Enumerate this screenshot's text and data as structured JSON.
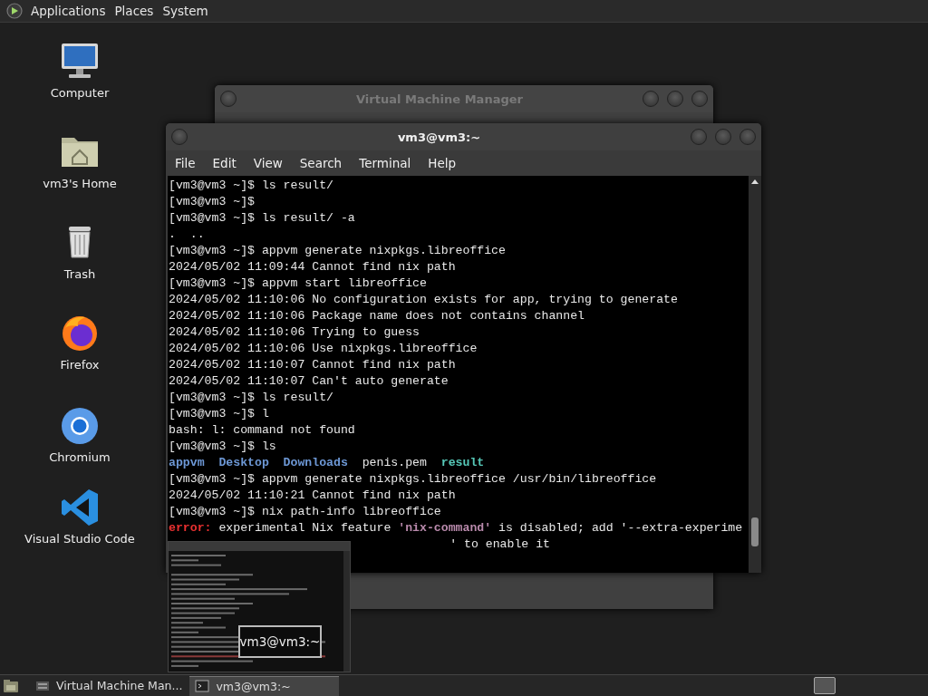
{
  "top_panel": {
    "menus": [
      {
        "label": "Applications"
      },
      {
        "label": "Places"
      },
      {
        "label": "System"
      }
    ]
  },
  "desktop_icons": [
    {
      "label": "Computer",
      "kind": "computer"
    },
    {
      "label": "vm3's Home",
      "kind": "home"
    },
    {
      "label": "Trash",
      "kind": "trash"
    },
    {
      "label": "Firefox",
      "kind": "firefox"
    },
    {
      "label": "Chromium",
      "kind": "chromium"
    },
    {
      "label": "Visual Studio Code",
      "kind": "code"
    }
  ],
  "background_window": {
    "title": "Virtual Machine Manager"
  },
  "terminal_window": {
    "title": "vm3@vm3:~",
    "menu": [
      {
        "label": "File"
      },
      {
        "label": "Edit"
      },
      {
        "label": "View"
      },
      {
        "label": "Search"
      },
      {
        "label": "Terminal"
      },
      {
        "label": "Help"
      }
    ],
    "lines": [
      {
        "segments": [
          {
            "text": "[vm3@vm3 ~]$ ls result/",
            "kind": "plain"
          }
        ]
      },
      {
        "segments": [
          {
            "text": "[vm3@vm3 ~]$",
            "kind": "plain"
          }
        ]
      },
      {
        "segments": [
          {
            "text": "[vm3@vm3 ~]$ ls result/ -a",
            "kind": "plain"
          }
        ]
      },
      {
        "segments": [
          {
            "text": ".  ..",
            "kind": "plain"
          }
        ]
      },
      {
        "segments": [
          {
            "text": "[vm3@vm3 ~]$ appvm generate nixpkgs.libreoffice",
            "kind": "plain"
          }
        ]
      },
      {
        "segments": [
          {
            "text": "2024/05/02 11:09:44 Cannot find nix path",
            "kind": "plain"
          }
        ]
      },
      {
        "segments": [
          {
            "text": "[vm3@vm3 ~]$ appvm start libreoffice",
            "kind": "plain"
          }
        ]
      },
      {
        "segments": [
          {
            "text": "2024/05/02 11:10:06 No configuration exists for app, trying to generate",
            "kind": "plain"
          }
        ]
      },
      {
        "segments": [
          {
            "text": "2024/05/02 11:10:06 Package name does not contains channel",
            "kind": "plain"
          }
        ]
      },
      {
        "segments": [
          {
            "text": "2024/05/02 11:10:06 Trying to guess",
            "kind": "plain"
          }
        ]
      },
      {
        "segments": [
          {
            "text": "2024/05/02 11:10:06 Use nixpkgs.libreoffice",
            "kind": "plain"
          }
        ]
      },
      {
        "segments": [
          {
            "text": "2024/05/02 11:10:07 Cannot find nix path",
            "kind": "plain"
          }
        ]
      },
      {
        "segments": [
          {
            "text": "2024/05/02 11:10:07 Can't auto generate",
            "kind": "plain"
          }
        ]
      },
      {
        "segments": [
          {
            "text": "[vm3@vm3 ~]$ ls result/",
            "kind": "plain"
          }
        ]
      },
      {
        "segments": [
          {
            "text": "[vm3@vm3 ~]$ l",
            "kind": "plain"
          }
        ]
      },
      {
        "segments": [
          {
            "text": "bash: l: command not found",
            "kind": "plain"
          }
        ]
      },
      {
        "segments": [
          {
            "text": "[vm3@vm3 ~]$ ls",
            "kind": "plain"
          }
        ]
      },
      {
        "segments": [
          {
            "text": "appvm  Desktop  Downloads",
            "kind": "dir"
          },
          {
            "text": "  penis.pem  ",
            "kind": "plain"
          },
          {
            "text": "result",
            "kind": "link"
          }
        ]
      },
      {
        "segments": [
          {
            "text": "[vm3@vm3 ~]$ appvm generate nixpkgs.libreoffice /usr/bin/libreoffice",
            "kind": "plain"
          }
        ]
      },
      {
        "segments": [
          {
            "text": "2024/05/02 11:10:21 Cannot find nix path",
            "kind": "plain"
          }
        ]
      },
      {
        "segments": [
          {
            "text": "[vm3@vm3 ~]$ nix path-info libreoffice",
            "kind": "plain"
          }
        ]
      },
      {
        "segments": [
          {
            "text": "error:",
            "kind": "error"
          },
          {
            "text": " experimental Nix feature ",
            "kind": "plain"
          },
          {
            "text": "'nix-command'",
            "kind": "emph"
          },
          {
            "text": " is disabled; add '--extra-experime",
            "kind": "plain"
          }
        ]
      },
      {
        "kind": "covered",
        "segments": [
          {
            "text": "' to enable it",
            "kind": "plain"
          }
        ]
      }
    ]
  },
  "window_preview": {
    "label": "vm3@vm3:~"
  },
  "taskbar": {
    "items": [
      {
        "label": "Virtual Machine Man...",
        "kind": "vmm",
        "selected": false
      },
      {
        "label": "vm3@vm3:~",
        "kind": "terminal",
        "selected": true
      }
    ]
  }
}
